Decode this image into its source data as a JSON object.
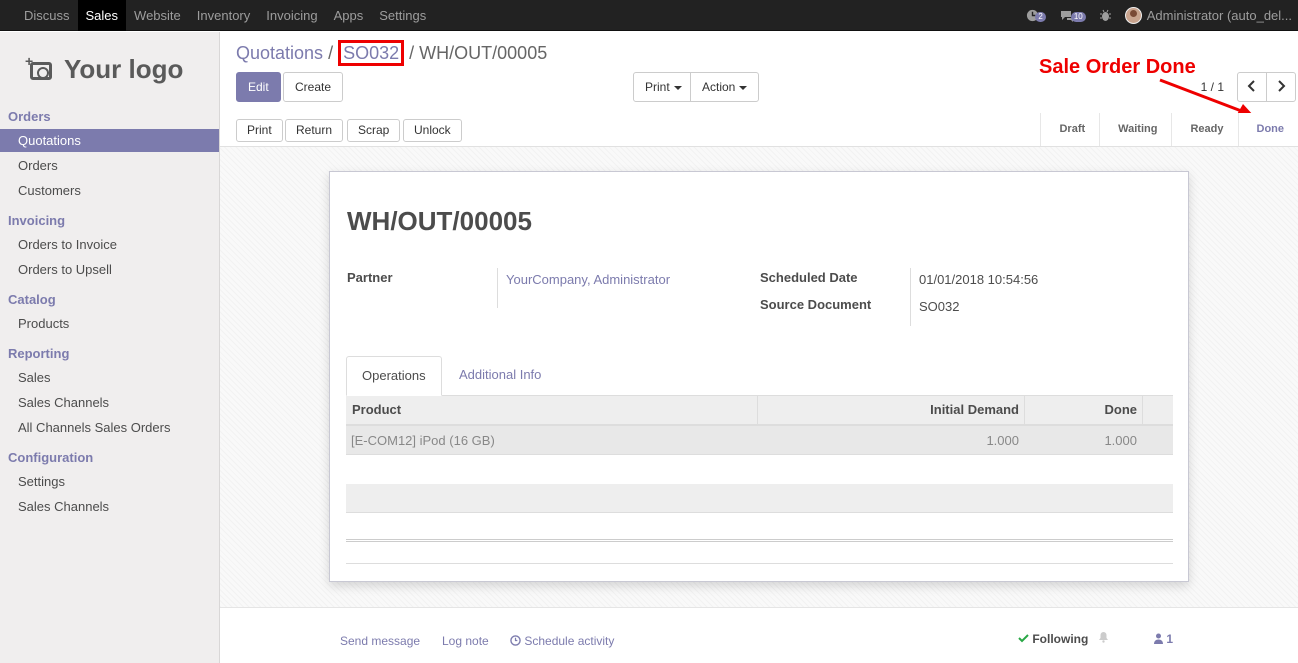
{
  "topbar": {
    "menu": [
      "Discuss",
      "Sales",
      "Website",
      "Inventory",
      "Invoicing",
      "Apps",
      "Settings"
    ],
    "activity_count": "2",
    "messages_count": "10",
    "user": "Administrator (auto_del..."
  },
  "sidebar": {
    "logo_text": "Your logo",
    "sections": [
      {
        "title": "Orders",
        "items": [
          "Quotations",
          "Orders",
          "Customers"
        ]
      },
      {
        "title": "Invoicing",
        "items": [
          "Orders to Invoice",
          "Orders to Upsell"
        ]
      },
      {
        "title": "Catalog",
        "items": [
          "Products"
        ]
      },
      {
        "title": "Reporting",
        "items": [
          "Sales",
          "Sales Channels",
          "All Channels Sales Orders"
        ]
      },
      {
        "title": "Configuration",
        "items": [
          "Settings",
          "Sales Channels"
        ]
      }
    ]
  },
  "breadcrumb": {
    "first": "Quotations",
    "second": "SO032",
    "current": "WH/OUT/00005"
  },
  "buttons": {
    "edit": "Edit",
    "create": "Create",
    "print": "Print",
    "action": "Action"
  },
  "pager": {
    "text": "1 / 1"
  },
  "annotation": "Sale Order Done",
  "status_buttons": [
    "Print",
    "Return",
    "Scrap",
    "Unlock"
  ],
  "stages": [
    "Draft",
    "Waiting",
    "Ready",
    "Done"
  ],
  "record": {
    "title": "WH/OUT/00005",
    "partner_label": "Partner",
    "partner": "YourCompany, Administrator",
    "scheduled_label": "Scheduled Date",
    "scheduled": "01/01/2018 10:54:56",
    "source_label": "Source Document",
    "source": "SO032"
  },
  "tabs": [
    "Operations",
    "Additional Info"
  ],
  "table": {
    "headers": [
      "Product",
      "Initial Demand",
      "Done"
    ],
    "rows": [
      [
        "[E-COM12] iPod (16 GB)",
        "1.000",
        "1.000"
      ]
    ]
  },
  "chatter": {
    "send": "Send message",
    "log": "Log note",
    "schedule": "Schedule activity",
    "following": "Following",
    "followers": "1"
  },
  "colors": {
    "accent": "#7c7bad",
    "annotation": "#e00000"
  }
}
